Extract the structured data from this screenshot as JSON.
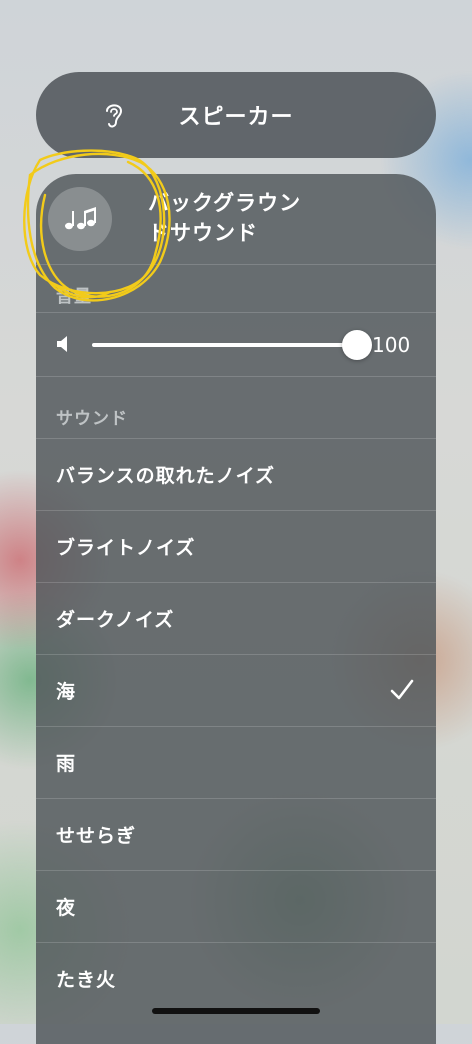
{
  "output_card": {
    "icon": "ear-icon",
    "title": "スピーカー"
  },
  "background_sounds": {
    "icon": "music-notes-icon",
    "title_line1": "バックグラウン",
    "title_line2": "ドサウンド",
    "volume_label": "音量",
    "volume_value": "100",
    "volume_level_percent": 100,
    "sounds_label": "サウンド",
    "sounds": [
      {
        "label": "バランスの取れたノイズ",
        "selected": false
      },
      {
        "label": "ブライトノイズ",
        "selected": false
      },
      {
        "label": "ダークノイズ",
        "selected": false
      },
      {
        "label": "海",
        "selected": true
      },
      {
        "label": "雨",
        "selected": false
      },
      {
        "label": "せせらぎ",
        "selected": false
      },
      {
        "label": "夜",
        "selected": false
      },
      {
        "label": "たき火",
        "selected": false
      }
    ]
  },
  "annotation_color": "#F2CB1A",
  "selected_check_icon": "checkmark-icon",
  "speaker_icon": "speaker-icon"
}
